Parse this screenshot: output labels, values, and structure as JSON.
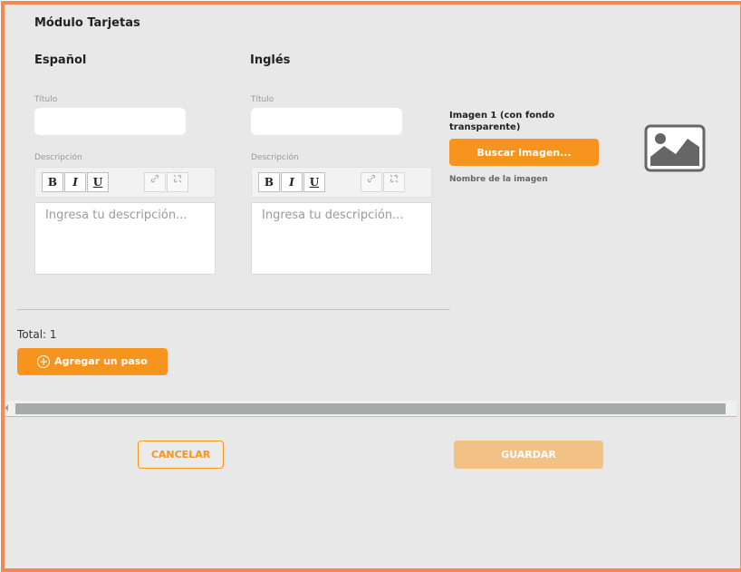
{
  "module": {
    "title": "Módulo Tarjetas"
  },
  "spanish": {
    "heading": "Español",
    "title_label": "Título",
    "title_value": "",
    "description_label": "Descripción",
    "description_placeholder": "Ingresa tu descripción..."
  },
  "english": {
    "heading": "Inglés",
    "title_label": "Título",
    "title_value": "",
    "description_label": "Descripción",
    "description_placeholder": "Ingresa tu descripción..."
  },
  "toolbar": {
    "bold": "B",
    "italic": "I",
    "underline": "U",
    "link_icon": "link-icon",
    "unlink_icon": "unlink-icon"
  },
  "image": {
    "label": "Imagen 1 (con fondo transparente)",
    "search_button": "Buscar imagen...",
    "name_label": "Nombre de la imagen",
    "placeholder_icon": "image-placeholder-icon"
  },
  "steps": {
    "total": "Total: 1",
    "add_button": "Agregar un paso"
  },
  "footer": {
    "cancel": "CANCELAR",
    "save": "GUARDAR"
  },
  "colors": {
    "accent": "#f7941d",
    "border": "#f5874f",
    "disabled_save": "#f2c186",
    "panel_bg": "#e8e8e8"
  }
}
